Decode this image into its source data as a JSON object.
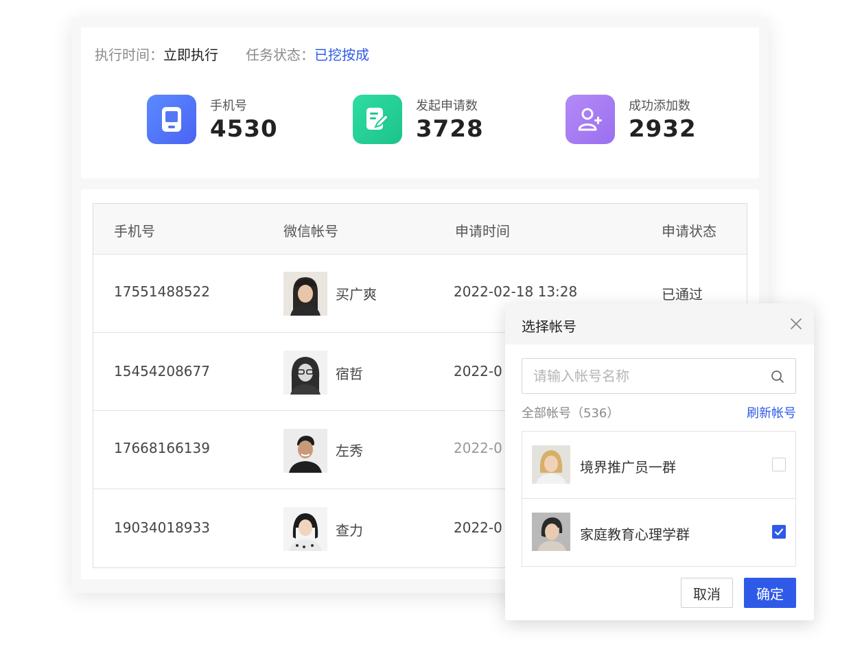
{
  "task": {
    "exec_time_label": "执行时间：",
    "exec_time_value": "立即执行",
    "status_label": "任务状态：",
    "status_value": "已挖按成",
    "status_color": "#2f5ae8"
  },
  "stats": [
    {
      "label": "手机号",
      "value": "4530",
      "icon": "phone-icon",
      "color": "#4f73f6"
    },
    {
      "label": "发起申请数",
      "value": "3728",
      "icon": "edit-document-icon",
      "color": "#22cf93"
    },
    {
      "label": "成功添加数",
      "value": "2932",
      "icon": "add-user-icon",
      "color": "#a77cf2"
    }
  ],
  "table": {
    "headers": [
      "手机号",
      "微信帐号",
      "申请时间",
      "申请状态"
    ],
    "rows": [
      {
        "phone": "17551488522",
        "name": "买广爽",
        "time": "2022-02-18 13:28",
        "status": "已通过"
      },
      {
        "phone": "15454208677",
        "name": "宿哲",
        "time": "2022-0",
        "status": ""
      },
      {
        "phone": "17668166139",
        "name": "左秀",
        "time": "2022-0",
        "status": ""
      },
      {
        "phone": "19034018933",
        "name": "查力",
        "time": "2022-0",
        "status": ""
      }
    ]
  },
  "dialog": {
    "title": "选择帐号",
    "search_placeholder": "请输入帐号名称",
    "list_label": "全部帐号（536）",
    "refresh_label": "刷新帐号",
    "accounts": [
      {
        "name": "境界推广员一群",
        "checked": false
      },
      {
        "name": "家庭教育心理学群",
        "checked": true
      }
    ],
    "cancel_label": "取消",
    "confirm_label": "确定"
  }
}
